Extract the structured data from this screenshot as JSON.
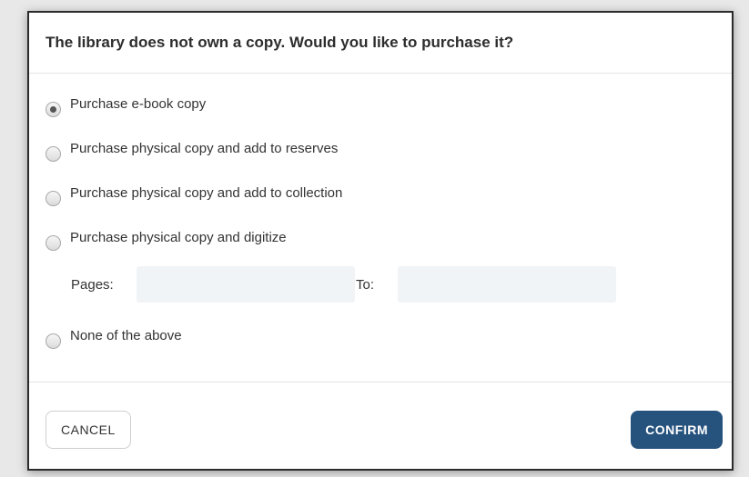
{
  "dialog": {
    "title": "The library does not own a copy. Would you like to purchase it?",
    "options": [
      {
        "label": "Purchase e-book copy",
        "selected": true
      },
      {
        "label": "Purchase physical copy and add to reserves",
        "selected": false
      },
      {
        "label": "Purchase physical copy and add to collection",
        "selected": false
      },
      {
        "label": "Purchase physical copy and digitize",
        "selected": false
      },
      {
        "label": "None of the above",
        "selected": false
      }
    ],
    "pages": {
      "from_label": "Pages:",
      "from_value": "",
      "to_label": "To:",
      "to_value": ""
    },
    "buttons": {
      "cancel_label": "CANCEL",
      "confirm_label": "CONFIRM"
    },
    "colors": {
      "confirm_bg": "#26527e",
      "input_bg": "#f0f4f6"
    }
  }
}
